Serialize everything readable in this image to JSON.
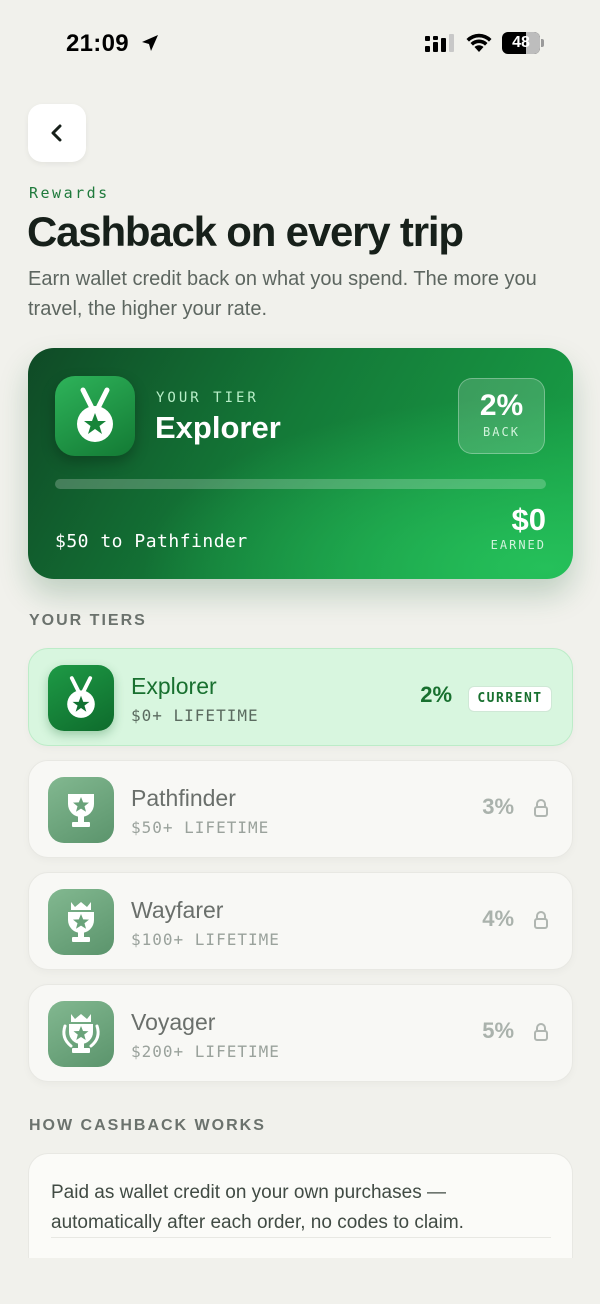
{
  "status_bar": {
    "time": "21:09",
    "battery": "48"
  },
  "header": {
    "eyebrow": "Rewards",
    "title": "Cashback on every trip",
    "subtitle": "Earn wallet credit back on what you spend. The more you travel, the higher your rate."
  },
  "hero": {
    "tier_label": "YOUR TIER",
    "tier_name": "Explorer",
    "rate": "2%",
    "rate_label": "BACK",
    "progress": 0,
    "next_tier_text": "$50 to Pathfinder",
    "earned": "$0",
    "earned_label": "EARNED"
  },
  "tiers_section": {
    "label": "YOUR TIERS",
    "items": [
      {
        "name": "Explorer",
        "threshold": "$0+ LIFETIME",
        "rate": "2%",
        "badge": "CURRENT",
        "icon": "medal-star-icon"
      },
      {
        "name": "Pathfinder",
        "threshold": "$50+ LIFETIME",
        "rate": "3%",
        "icon": "trophy-star-icon"
      },
      {
        "name": "Wayfarer",
        "threshold": "$100+ LIFETIME",
        "rate": "4%",
        "icon": "crowned-trophy-icon"
      },
      {
        "name": "Voyager",
        "threshold": "$200+ LIFETIME",
        "rate": "5%",
        "icon": "laurel-crown-trophy-icon"
      }
    ]
  },
  "how_section": {
    "label": "HOW CASHBACK WORKS",
    "text": "Paid as wallet credit on your own purchases — automatically after each order, no codes to claim."
  },
  "colors": {
    "accent": "#18702f",
    "hero_start": "#0f4a26",
    "hero_end": "#25c05a",
    "current_bg": "#d8f6df"
  }
}
